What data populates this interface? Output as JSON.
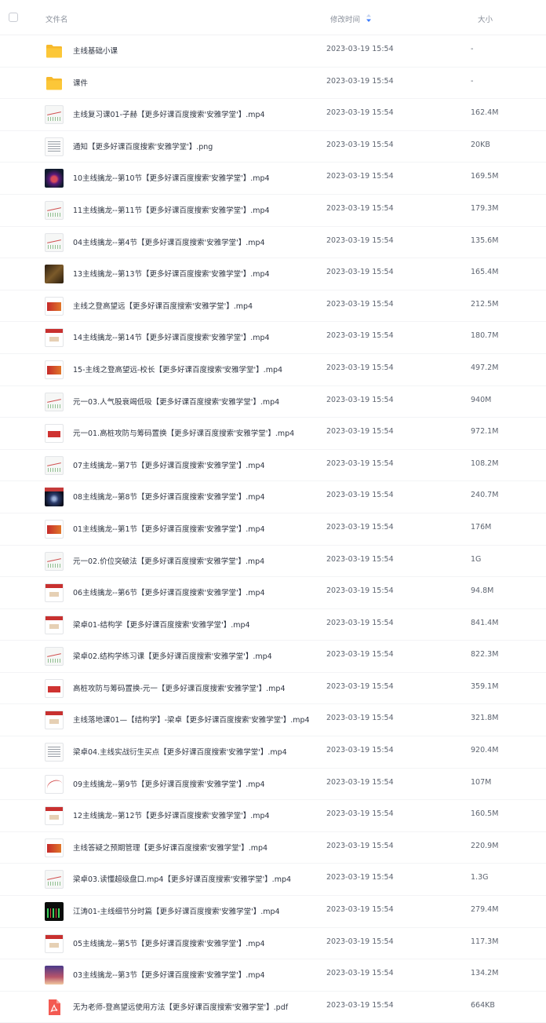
{
  "header": {
    "name_label": "文件名",
    "time_label": "修改时间",
    "size_label": "大小"
  },
  "files": [
    {
      "icon": "folder-icon",
      "thumb": "t-folder",
      "name": "主线基础小课",
      "time": "2023-03-19 15:54",
      "size": "-"
    },
    {
      "icon": "folder-icon",
      "thumb": "t-folder",
      "name": "课件",
      "time": "2023-03-19 15:54",
      "size": "-"
    },
    {
      "icon": "video-thumbnail-icon",
      "thumb": "t-chart",
      "name": "主线复习课01-子赫【更多好课百度搜索'安雅学堂'】.mp4",
      "time": "2023-03-19 15:54",
      "size": "162.4M"
    },
    {
      "icon": "image-thumbnail-icon",
      "thumb": "t-doc",
      "name": "通知【更多好课百度搜索'安雅学堂'】.png",
      "time": "2023-03-19 15:54",
      "size": "20KB"
    },
    {
      "icon": "video-thumbnail-icon",
      "thumb": "t-dark",
      "name": "10主线擒龙--第10节【更多好课百度搜索'安雅学堂'】.mp4",
      "time": "2023-03-19 15:54",
      "size": "169.5M"
    },
    {
      "icon": "video-thumbnail-icon",
      "thumb": "t-chart",
      "name": "11主线擒龙--第11节【更多好课百度搜索'安雅学堂'】.mp4",
      "time": "2023-03-19 15:54",
      "size": "179.3M"
    },
    {
      "icon": "video-thumbnail-icon",
      "thumb": "t-chart",
      "name": "04主线擒龙--第4节【更多好课百度搜索'安雅学堂'】.mp4",
      "time": "2023-03-19 15:54",
      "size": "135.6M"
    },
    {
      "icon": "video-thumbnail-icon",
      "thumb": "t-gold",
      "name": "13主线擒龙--第13节【更多好课百度搜索'安雅学堂'】.mp4",
      "time": "2023-03-19 15:54",
      "size": "165.4M"
    },
    {
      "icon": "video-thumbnail-icon",
      "thumb": "t-redtitle",
      "name": "主线之登高望远【更多好课百度搜索'安雅学堂'】.mp4",
      "time": "2023-03-19 15:54",
      "size": "212.5M"
    },
    {
      "icon": "video-thumbnail-icon",
      "thumb": "t-slide",
      "name": "14主线擒龙--第14节【更多好课百度搜索'安雅学堂'】.mp4",
      "time": "2023-03-19 15:54",
      "size": "180.7M"
    },
    {
      "icon": "video-thumbnail-icon",
      "thumb": "t-redtitle",
      "name": "15-主线之登高望远-校长【更多好课百度搜索'安雅学堂'】.mp4",
      "time": "2023-03-19 15:54",
      "size": "497.2M"
    },
    {
      "icon": "video-thumbnail-icon",
      "thumb": "t-chart",
      "name": "元一03.人气股衰竭低吸【更多好课百度搜索'安雅学堂'】.mp4",
      "time": "2023-03-19 15:54",
      "size": "940M"
    },
    {
      "icon": "video-thumbnail-icon",
      "thumb": "t-redblock",
      "name": "元一01.高桩攻防与筹码置换【更多好课百度搜索'安雅学堂'】.mp4",
      "time": "2023-03-19 15:54",
      "size": "972.1M"
    },
    {
      "icon": "video-thumbnail-icon",
      "thumb": "t-chart",
      "name": "07主线擒龙--第7节【更多好课百度搜索'安雅学堂'】.mp4",
      "time": "2023-03-19 15:54",
      "size": "108.2M"
    },
    {
      "icon": "video-thumbnail-icon",
      "thumb": "t-vortex",
      "name": "08主线擒龙--第8节【更多好课百度搜索'安雅学堂'】.mp4",
      "time": "2023-03-19 15:54",
      "size": "240.7M"
    },
    {
      "icon": "video-thumbnail-icon",
      "thumb": "t-redtitle",
      "name": "01主线擒龙--第1节【更多好课百度搜索'安雅学堂'】.mp4",
      "time": "2023-03-19 15:54",
      "size": "176M"
    },
    {
      "icon": "video-thumbnail-icon",
      "thumb": "t-chart",
      "name": "元一02.价位突破法【更多好课百度搜索'安雅学堂'】.mp4",
      "time": "2023-03-19 15:54",
      "size": "1G"
    },
    {
      "icon": "video-thumbnail-icon",
      "thumb": "t-slide",
      "name": "06主线擒龙--第6节【更多好课百度搜索'安雅学堂'】.mp4",
      "time": "2023-03-19 15:54",
      "size": "94.8M"
    },
    {
      "icon": "video-thumbnail-icon",
      "thumb": "t-slide",
      "name": "梁卓01-结构学【更多好课百度搜索'安雅学堂'】.mp4",
      "time": "2023-03-19 15:54",
      "size": "841.4M"
    },
    {
      "icon": "video-thumbnail-icon",
      "thumb": "t-chart",
      "name": "梁卓02.结构学练习课【更多好课百度搜索'安雅学堂'】.mp4",
      "time": "2023-03-19 15:54",
      "size": "822.3M"
    },
    {
      "icon": "video-thumbnail-icon",
      "thumb": "t-redblock",
      "name": "高桩攻防与筹码置换-元一【更多好课百度搜索'安雅学堂'】.mp4",
      "time": "2023-03-19 15:54",
      "size": "359.1M"
    },
    {
      "icon": "video-thumbnail-icon",
      "thumb": "t-slide",
      "name": "主线落地课01—【结构学】-梁卓【更多好课百度搜索'安雅学堂'】.mp4",
      "time": "2023-03-19 15:54",
      "size": "321.8M"
    },
    {
      "icon": "video-thumbnail-icon",
      "thumb": "t-doc",
      "name": "梁卓04.主线实战衍生买点【更多好课百度搜索'安雅学堂'】.mp4",
      "time": "2023-03-19 15:54",
      "size": "920.4M"
    },
    {
      "icon": "video-thumbnail-icon",
      "thumb": "t-curve",
      "name": "09主线擒龙--第9节【更多好课百度搜索'安雅学堂'】.mp4",
      "time": "2023-03-19 15:54",
      "size": "107M"
    },
    {
      "icon": "video-thumbnail-icon",
      "thumb": "t-slide",
      "name": "12主线擒龙--第12节【更多好课百度搜索'安雅学堂'】.mp4",
      "time": "2023-03-19 15:54",
      "size": "160.5M"
    },
    {
      "icon": "video-thumbnail-icon",
      "thumb": "t-redtitle",
      "name": "主线答疑之预期管理【更多好课百度搜索'安雅学堂'】.mp4",
      "time": "2023-03-19 15:54",
      "size": "220.9M"
    },
    {
      "icon": "video-thumbnail-icon",
      "thumb": "t-chart",
      "name": "梁卓03.读懂超级盘口.mp4【更多好课百度搜索'安雅学堂'】.mp4",
      "time": "2023-03-19 15:54",
      "size": "1.3G"
    },
    {
      "icon": "video-thumbnail-icon",
      "thumb": "t-green",
      "name": "江涛01-主线细节分时篇【更多好课百度搜索'安雅学堂'】.mp4",
      "time": "2023-03-19 15:54",
      "size": "279.4M"
    },
    {
      "icon": "video-thumbnail-icon",
      "thumb": "t-slide",
      "name": "05主线擒龙--第5节【更多好课百度搜索'安雅学堂'】.mp4",
      "time": "2023-03-19 15:54",
      "size": "117.3M"
    },
    {
      "icon": "video-thumbnail-icon",
      "thumb": "t-purple",
      "name": "03主线擒龙--第3节【更多好课百度搜索'安雅学堂'】.mp4",
      "time": "2023-03-19 15:54",
      "size": "134.2M"
    },
    {
      "icon": "pdf-icon",
      "thumb": "t-pdf",
      "name": "无为老师-登高望远使用方法【更多好课百度搜索'安雅学堂'】.pdf",
      "time": "2023-03-19 15:54",
      "size": "664KB"
    }
  ]
}
